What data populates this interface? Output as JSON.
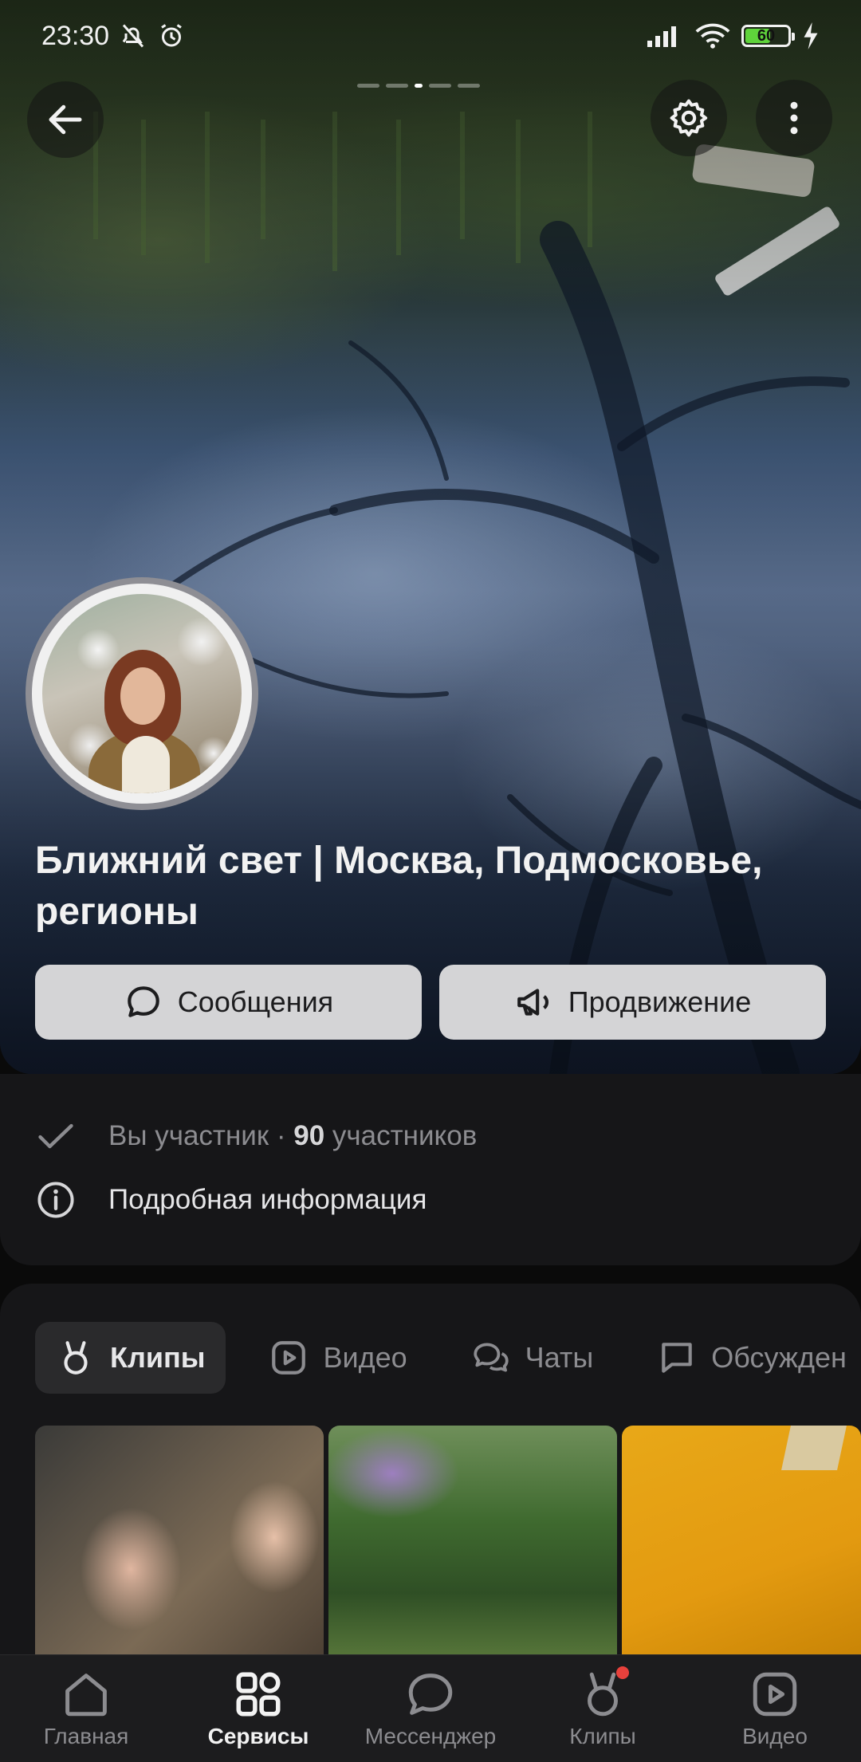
{
  "status_bar": {
    "time": "23:30",
    "battery": "60"
  },
  "group": {
    "title": "Ближний свет | Москва, Подмосковье, регионы",
    "actions": {
      "messages": "Сообщения",
      "promote": "Продвижение"
    }
  },
  "membership": {
    "member_label": "Вы участник",
    "separator": " · ",
    "count": "90",
    "count_suffix": " участников",
    "details": "Подробная информация"
  },
  "tabs": [
    {
      "label": "Клипы",
      "active": true
    },
    {
      "label": "Видео"
    },
    {
      "label": "Чаты"
    },
    {
      "label": "Обсужден"
    }
  ],
  "bottom_nav": [
    {
      "label": "Главная"
    },
    {
      "label": "Сервисы",
      "active": true
    },
    {
      "label": "Мессенджер"
    },
    {
      "label": "Клипы",
      "has_badge": true
    },
    {
      "label": "Видео"
    }
  ],
  "colors": {
    "accent_button": "#d4d4d6",
    "badge": "#e8413c",
    "battery": "#5fd33b"
  }
}
